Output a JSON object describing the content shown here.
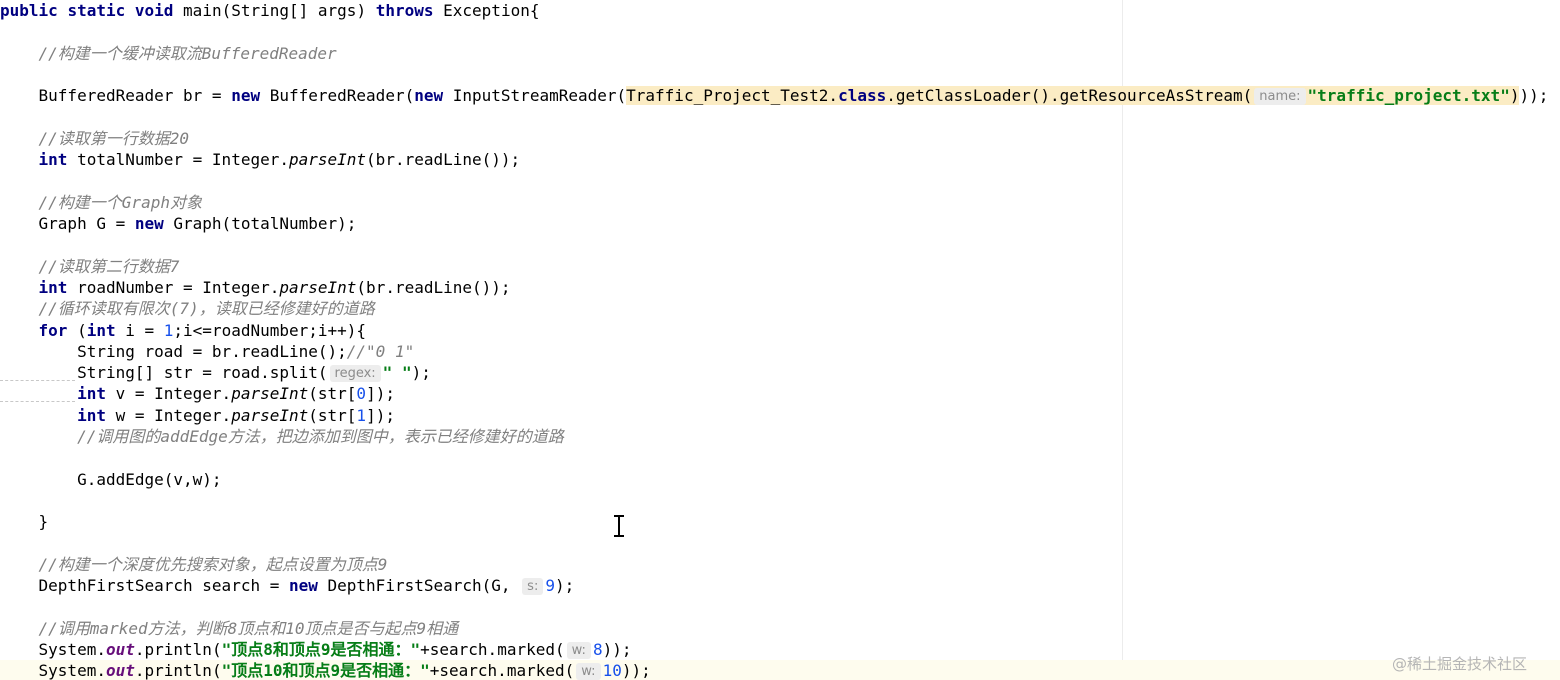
{
  "editor": {
    "lines": [
      {
        "indent": "",
        "tokens": [
          {
            "t": "public ",
            "c": "kw"
          },
          {
            "t": "static ",
            "c": "kw"
          },
          {
            "t": "void ",
            "c": "kw"
          },
          {
            "t": "main(String[] args) "
          },
          {
            "t": "throws ",
            "c": "kw"
          },
          {
            "t": "Exception{"
          }
        ]
      },
      {
        "indent": "",
        "tokens": []
      },
      {
        "indent": "    ",
        "tokens": [
          {
            "t": "//构建一个缓冲读取流BufferedReader",
            "c": "cm"
          }
        ]
      },
      {
        "indent": "",
        "tokens": []
      },
      {
        "indent": "    ",
        "tokens": [
          {
            "t": "BufferedReader br = "
          },
          {
            "t": "new ",
            "c": "kw"
          },
          {
            "t": "BufferedReader("
          },
          {
            "t": "new ",
            "c": "kw"
          },
          {
            "t": "InputStreamReader("
          },
          {
            "t": "Traffic_Project_Test2.",
            "c": "hl"
          },
          {
            "t": "class",
            "c": "kw hl"
          },
          {
            "t": ".getClassLoader().getResourceAsStream(",
            "c": "hl"
          },
          {
            "hint": "name:",
            "c": "hl"
          },
          {
            "t": "\"traffic_project.txt\"",
            "c": "st hl"
          },
          {
            "t": ")",
            "c": "hl"
          },
          {
            "t": "));"
          }
        ]
      },
      {
        "indent": "",
        "tokens": []
      },
      {
        "indent": "    ",
        "tokens": [
          {
            "t": "//读取第一行数据20",
            "c": "cm"
          }
        ]
      },
      {
        "indent": "    ",
        "tokens": [
          {
            "t": "int ",
            "c": "kw"
          },
          {
            "t": "totalNumber = Integer."
          },
          {
            "t": "parseInt",
            "c": "it"
          },
          {
            "t": "(br.readLine());"
          }
        ]
      },
      {
        "indent": "",
        "tokens": []
      },
      {
        "indent": "    ",
        "tokens": [
          {
            "t": "//构建一个Graph对象",
            "c": "cm"
          }
        ]
      },
      {
        "indent": "    ",
        "tokens": [
          {
            "t": "Graph G = "
          },
          {
            "t": "new ",
            "c": "kw"
          },
          {
            "t": "Graph(totalNumber);"
          }
        ]
      },
      {
        "indent": "",
        "tokens": []
      },
      {
        "indent": "    ",
        "tokens": [
          {
            "t": "//读取第二行数据7",
            "c": "cm"
          }
        ]
      },
      {
        "indent": "    ",
        "tokens": [
          {
            "t": "int ",
            "c": "kw"
          },
          {
            "t": "roadNumber = Integer."
          },
          {
            "t": "parseInt",
            "c": "it"
          },
          {
            "t": "(br.readLine());"
          }
        ]
      },
      {
        "indent": "    ",
        "tokens": [
          {
            "t": "//循环读取有限次(7)，读取已经修建好的道路",
            "c": "cm"
          }
        ]
      },
      {
        "indent": "    ",
        "tokens": [
          {
            "t": "for ",
            "c": "kw"
          },
          {
            "t": "("
          },
          {
            "t": "int ",
            "c": "kw"
          },
          {
            "t": "i = "
          },
          {
            "t": "1",
            "c": "nm"
          },
          {
            "t": ";i<=roadNumber;i++){"
          }
        ]
      },
      {
        "indent": "        ",
        "tokens": [
          {
            "t": "String road = br.readLine();"
          },
          {
            "t": "//\"0 1\"",
            "c": "cm"
          }
        ]
      },
      {
        "indent": "        ",
        "tokens": [
          {
            "t": "String[] str = road.split("
          },
          {
            "hint": "regex:"
          },
          {
            "t": "\" \"",
            "c": "st"
          },
          {
            "t": ");"
          }
        ]
      },
      {
        "indent": "        ",
        "tokens": [
          {
            "t": "int ",
            "c": "kw"
          },
          {
            "t": "v = Integer."
          },
          {
            "t": "parseInt",
            "c": "it"
          },
          {
            "t": "(str["
          },
          {
            "t": "0",
            "c": "nm"
          },
          {
            "t": "]);"
          }
        ]
      },
      {
        "indent": "        ",
        "tokens": [
          {
            "t": "int ",
            "c": "kw"
          },
          {
            "t": "w = Integer."
          },
          {
            "t": "parseInt",
            "c": "it"
          },
          {
            "t": "(str["
          },
          {
            "t": "1",
            "c": "nm"
          },
          {
            "t": "]);"
          }
        ]
      },
      {
        "indent": "        ",
        "tokens": [
          {
            "t": "//调用图的addEdge方法，把边添加到图中，表示已经修建好的道路",
            "c": "cm"
          }
        ]
      },
      {
        "indent": "",
        "tokens": []
      },
      {
        "indent": "        ",
        "tokens": [
          {
            "t": "G.addEdge(v,w);"
          }
        ]
      },
      {
        "indent": "",
        "tokens": []
      },
      {
        "indent": "    ",
        "tokens": [
          {
            "t": "}"
          }
        ]
      },
      {
        "indent": "",
        "tokens": []
      },
      {
        "indent": "    ",
        "tokens": [
          {
            "t": "//构建一个深度优先搜索对象，起点设置为顶点9",
            "c": "cm"
          }
        ]
      },
      {
        "indent": "    ",
        "tokens": [
          {
            "t": "DepthFirstSearch search = "
          },
          {
            "t": "new ",
            "c": "kw"
          },
          {
            "t": "DepthFirstSearch(G, "
          },
          {
            "hint": "s:"
          },
          {
            "t": "9",
            "c": "nm"
          },
          {
            "t": ");"
          }
        ]
      },
      {
        "indent": "",
        "tokens": []
      },
      {
        "indent": "    ",
        "tokens": [
          {
            "t": "//调用marked方法，判断8顶点和10顶点是否与起点9相通",
            "c": "cm"
          }
        ]
      },
      {
        "indent": "    ",
        "tokens": [
          {
            "t": "System."
          },
          {
            "t": "out",
            "c": "fld"
          },
          {
            "t": ".println("
          },
          {
            "t": "\"顶点8和顶点9是否相通：\"",
            "c": "st"
          },
          {
            "t": "+search.marked("
          },
          {
            "hint": "w:"
          },
          {
            "t": "8",
            "c": "nm"
          },
          {
            "t": "));"
          }
        ]
      },
      {
        "indent": "    ",
        "current": true,
        "tokens": [
          {
            "t": "System."
          },
          {
            "t": "out",
            "c": "fld"
          },
          {
            "t": ".println("
          },
          {
            "t": "\"顶点10和顶点9是否相通：\"",
            "c": "st"
          },
          {
            "t": "+search.marked("
          },
          {
            "hint": "w:"
          },
          {
            "t": "10",
            "c": "nm"
          },
          {
            "t": "));"
          }
        ]
      }
    ]
  },
  "watermark": "@稀土掘金技术社区"
}
